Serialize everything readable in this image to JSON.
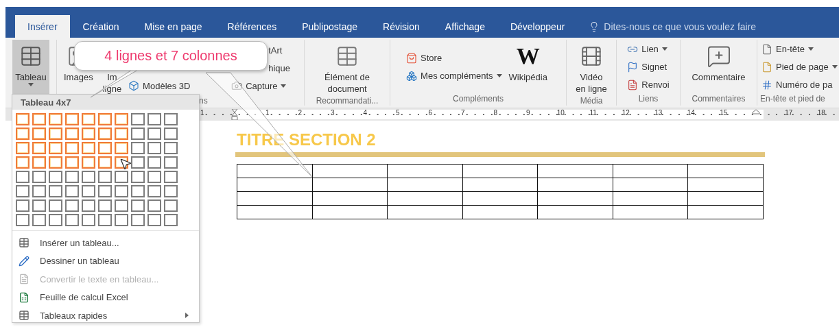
{
  "tabs": [
    {
      "label": "Insérer",
      "selected": true
    },
    {
      "label": "Création",
      "selected": false
    },
    {
      "label": "Mise en page",
      "selected": false
    },
    {
      "label": "Références",
      "selected": false
    },
    {
      "label": "Publipostage",
      "selected": false
    },
    {
      "label": "Révision",
      "selected": false
    },
    {
      "label": "Affichage",
      "selected": false
    },
    {
      "label": "Développeur",
      "selected": false
    }
  ],
  "tell_me": {
    "placeholder": "Dites-nous ce que vous voulez faire"
  },
  "ribbon": {
    "groups": [
      {
        "columns": [
          {
            "kind": "large",
            "lines": [
              "Tableau"
            ],
            "dropdown": true,
            "pressed": true
          }
        ]
      },
      {
        "label": "ns",
        "columns": [
          {
            "kind": "large",
            "lines": [
              "Images"
            ]
          },
          {
            "kind": "large",
            "lines": [
              "Im",
              "ligne"
            ]
          },
          {
            "kind": "small",
            "items": [
              {
                "label": "Modèles 3D"
              }
            ]
          },
          {
            "kind": "small",
            "items": [
              {
                "label": "tArt"
              },
              {
                "label": "hique"
              },
              {
                "label": "Capture",
                "dropdown": true
              }
            ]
          }
        ]
      },
      {
        "label": "Recommandati...",
        "columns": [
          {
            "kind": "large",
            "lines": [
              "Élément de",
              "document"
            ]
          }
        ]
      },
      {
        "label": "Compléments",
        "columns": [
          {
            "kind": "small",
            "items": [
              {
                "label": "Store"
              },
              {
                "label": "Mes compléments",
                "dropdown": true
              }
            ]
          },
          {
            "kind": "large",
            "lines": [
              "Wikipédia"
            ],
            "icon_text": "W"
          }
        ]
      },
      {
        "label": "Média",
        "columns": [
          {
            "kind": "large",
            "lines": [
              "Vidéo",
              "en ligne"
            ]
          }
        ]
      },
      {
        "label": "Liens",
        "columns": [
          {
            "kind": "small",
            "items": [
              {
                "label": "Lien",
                "dropdown": true
              },
              {
                "label": "Signet"
              },
              {
                "label": "Renvoi"
              }
            ]
          }
        ]
      },
      {
        "label": "Commentaires",
        "columns": [
          {
            "kind": "large",
            "lines": [
              "Commentaire"
            ]
          }
        ]
      },
      {
        "label": "En-tête et pied de",
        "columns": [
          {
            "kind": "small",
            "items": [
              {
                "label": "En-tête",
                "dropdown": true
              },
              {
                "label": "Pied de page",
                "dropdown": true
              },
              {
                "label": "Numéro de pa"
              }
            ]
          }
        ]
      }
    ]
  },
  "ruler": {
    "marks": [
      {
        "kind": "number",
        "label": "1"
      },
      {
        "kind": "indent"
      },
      {
        "kind": "number",
        "label": "1"
      },
      {
        "kind": "number",
        "label": "2"
      },
      {
        "kind": "number",
        "label": "3"
      },
      {
        "kind": "number",
        "label": "4"
      },
      {
        "kind": "number",
        "label": "5"
      },
      {
        "kind": "number",
        "label": "6"
      },
      {
        "kind": "number",
        "label": "7"
      },
      {
        "kind": "number",
        "label": "8"
      },
      {
        "kind": "number",
        "label": "9"
      },
      {
        "kind": "number",
        "label": "10"
      },
      {
        "kind": "number",
        "label": "11"
      },
      {
        "kind": "number",
        "label": "12"
      },
      {
        "kind": "number",
        "label": "13"
      },
      {
        "kind": "number",
        "label": "14"
      },
      {
        "kind": "number",
        "label": "15"
      },
      {
        "kind": "tab"
      },
      {
        "kind": "number",
        "label": "17"
      },
      {
        "kind": "number",
        "label": "18"
      }
    ]
  },
  "document": {
    "heading": "TITRE SECTION 2",
    "table": {
      "rows": [
        {
          "cells": [
            {},
            {},
            {},
            {},
            {},
            {},
            {}
          ]
        },
        {
          "cells": [
            {},
            {},
            {},
            {},
            {},
            {},
            {}
          ]
        },
        {
          "cells": [
            {},
            {},
            {},
            {},
            {},
            {},
            {}
          ]
        },
        {
          "cells": [
            {},
            {},
            {},
            {},
            {},
            {},
            {}
          ]
        }
      ]
    }
  },
  "table_menu": {
    "title": "Tableau 4x7",
    "grid": [
      {
        "cells": [
          {
            "selected": true
          },
          {
            "selected": true
          },
          {
            "selected": true
          },
          {
            "selected": true
          },
          {
            "selected": true
          },
          {
            "selected": true
          },
          {
            "selected": true
          },
          {
            "selected": false
          },
          {
            "selected": false
          },
          {
            "selected": false
          }
        ]
      },
      {
        "cells": [
          {
            "selected": true
          },
          {
            "selected": true
          },
          {
            "selected": true
          },
          {
            "selected": true
          },
          {
            "selected": true
          },
          {
            "selected": true
          },
          {
            "selected": true
          },
          {
            "selected": false
          },
          {
            "selected": false
          },
          {
            "selected": false
          }
        ]
      },
      {
        "cells": [
          {
            "selected": true
          },
          {
            "selected": true
          },
          {
            "selected": true
          },
          {
            "selected": true
          },
          {
            "selected": true
          },
          {
            "selected": true
          },
          {
            "selected": true
          },
          {
            "selected": false
          },
          {
            "selected": false
          },
          {
            "selected": false
          }
        ]
      },
      {
        "cells": [
          {
            "selected": true
          },
          {
            "selected": true
          },
          {
            "selected": true
          },
          {
            "selected": true
          },
          {
            "selected": true
          },
          {
            "selected": true
          },
          {
            "selected": true
          },
          {
            "selected": false
          },
          {
            "selected": false
          },
          {
            "selected": false
          }
        ]
      },
      {
        "cells": [
          {
            "selected": false
          },
          {
            "selected": false
          },
          {
            "selected": false
          },
          {
            "selected": false
          },
          {
            "selected": false
          },
          {
            "selected": false
          },
          {
            "selected": false
          },
          {
            "selected": false
          },
          {
            "selected": false
          },
          {
            "selected": false
          }
        ]
      },
      {
        "cells": [
          {
            "selected": false
          },
          {
            "selected": false
          },
          {
            "selected": false
          },
          {
            "selected": false
          },
          {
            "selected": false
          },
          {
            "selected": false
          },
          {
            "selected": false
          },
          {
            "selected": false
          },
          {
            "selected": false
          },
          {
            "selected": false
          }
        ]
      },
      {
        "cells": [
          {
            "selected": false
          },
          {
            "selected": false
          },
          {
            "selected": false
          },
          {
            "selected": false
          },
          {
            "selected": false
          },
          {
            "selected": false
          },
          {
            "selected": false
          },
          {
            "selected": false
          },
          {
            "selected": false
          },
          {
            "selected": false
          }
        ]
      },
      {
        "cells": [
          {
            "selected": false
          },
          {
            "selected": false
          },
          {
            "selected": false
          },
          {
            "selected": false
          },
          {
            "selected": false
          },
          {
            "selected": false
          },
          {
            "selected": false
          },
          {
            "selected": false
          },
          {
            "selected": false
          },
          {
            "selected": false
          }
        ]
      }
    ],
    "items": [
      {
        "label": "Insérer un tableau...",
        "disabled": false
      },
      {
        "label": "Dessiner un tableau",
        "disabled": false
      },
      {
        "label": "Convertir le texte en tableau...",
        "disabled": true
      },
      {
        "label": "Feuille de calcul Excel",
        "disabled": false
      },
      {
        "label": "Tableaux rapides",
        "disabled": false,
        "submenu": true
      }
    ]
  },
  "callout": {
    "text": "4 lignes et 7 colonnes"
  }
}
